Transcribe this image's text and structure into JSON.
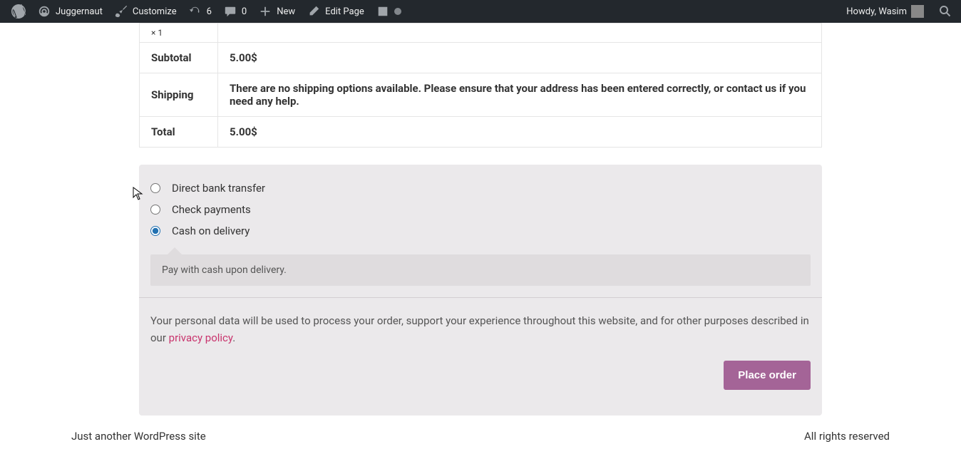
{
  "adminbar": {
    "site_name": "Juggernaut",
    "customize": "Customize",
    "updates": "6",
    "comments": "0",
    "new": "New",
    "edit_page": "Edit Page",
    "howdy": "Howdy, Wasim"
  },
  "order": {
    "qty_prefix": "×",
    "qty": "1",
    "subtotal_label": "Subtotal",
    "subtotal_value": "5.00$",
    "shipping_label": "Shipping",
    "shipping_value": "There are no shipping options available. Please ensure that your address has been entered correctly, or contact us if you need any help.",
    "total_label": "Total",
    "total_value": "5.00$"
  },
  "payment": {
    "methods": {
      "bacs": "Direct bank transfer",
      "cheque": "Check payments",
      "cod": "Cash on delivery"
    },
    "cod_desc": "Pay with cash upon delivery.",
    "privacy_text_before": "Your personal data will be used to process your order, support your experience throughout this website, and for other purposes described in our ",
    "privacy_link": "privacy policy",
    "privacy_text_after": ".",
    "place_order": "Place order"
  },
  "footer": {
    "left": "Just another WordPress site",
    "right": "All rights reserved"
  }
}
